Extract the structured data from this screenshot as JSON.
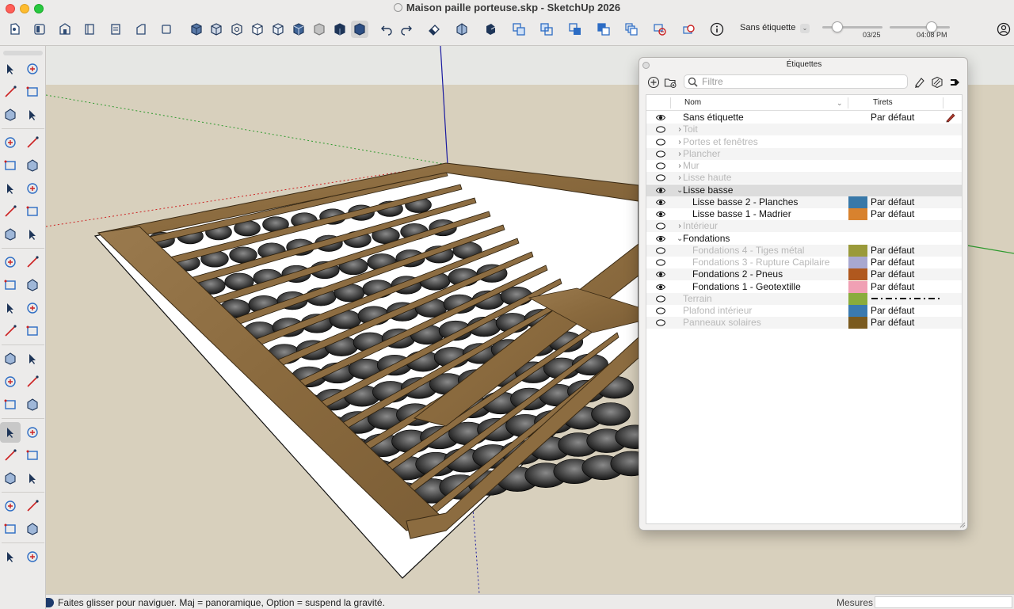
{
  "window": {
    "title": "Maison paille porteuse.skp - SketchUp 2026"
  },
  "toolbar": {
    "tag_select": "Sans étiquette",
    "date_slider_value": "03/25",
    "time_slider_value": "04:08 PM"
  },
  "status_bar": {
    "hint": "Faites glisser pour naviguer. Maj = panoramique, Option =  suspend la gravité.",
    "measurements_label": "Mesures",
    "measurements_value": ""
  },
  "tags_panel": {
    "title": "Étiquettes",
    "search_placeholder": "Filtre",
    "col_name": "Nom",
    "col_dashes": "Tirets",
    "rows": [
      {
        "name": "Sans étiquette",
        "visible": true,
        "level": 0,
        "disclosure": "",
        "color": "",
        "dashes": "Par défaut",
        "active": true
      },
      {
        "name": "Toit",
        "visible": false,
        "level": 0,
        "disclosure": "›",
        "color": "",
        "dashes": ""
      },
      {
        "name": "Portes et fenêtres",
        "visible": false,
        "level": 0,
        "disclosure": "›",
        "color": "",
        "dashes": ""
      },
      {
        "name": "Plancher",
        "visible": false,
        "level": 0,
        "disclosure": "›",
        "color": "",
        "dashes": ""
      },
      {
        "name": "Mur",
        "visible": false,
        "level": 0,
        "disclosure": "›",
        "color": "",
        "dashes": ""
      },
      {
        "name": "Lisse haute",
        "visible": false,
        "level": 0,
        "disclosure": "›",
        "color": "",
        "dashes": ""
      },
      {
        "name": "Lisse basse",
        "visible": true,
        "level": 0,
        "disclosure": "⌄",
        "color": "",
        "dashes": "",
        "selected": true
      },
      {
        "name": "Lisse basse 2 - Planches",
        "visible": true,
        "level": 1,
        "disclosure": "",
        "color": "#3878a8",
        "dashes": "Par défaut"
      },
      {
        "name": "Lisse basse 1 - Madrier",
        "visible": true,
        "level": 1,
        "disclosure": "",
        "color": "#d8822e",
        "dashes": "Par défaut"
      },
      {
        "name": "Intérieur",
        "visible": false,
        "level": 0,
        "disclosure": "›",
        "color": "",
        "dashes": ""
      },
      {
        "name": "Fondations",
        "visible": true,
        "level": 0,
        "disclosure": "⌄",
        "color": "",
        "dashes": ""
      },
      {
        "name": "Fondations 4 - Tiges métal",
        "visible": false,
        "level": 1,
        "disclosure": "",
        "color": "#9a9a3a",
        "dashes": "Par défaut"
      },
      {
        "name": "Fondations 3 - Rupture Capilaire",
        "visible": false,
        "level": 1,
        "disclosure": "",
        "color": "#a8a8d0",
        "dashes": "Par défaut"
      },
      {
        "name": "Fondations 2 - Pneus",
        "visible": true,
        "level": 1,
        "disclosure": "",
        "color": "#b0581e",
        "dashes": "Par défaut"
      },
      {
        "name": "Fondations 1 - Geotextille",
        "visible": true,
        "level": 1,
        "disclosure": "",
        "color": "#f0a0b4",
        "dashes": "Par défaut"
      },
      {
        "name": "Terrain",
        "visible": false,
        "level": 0,
        "disclosure": "",
        "color": "#8aac3c",
        "dashes": "",
        "dash_pattern": true
      },
      {
        "name": "Plafond intérieur",
        "visible": false,
        "level": 0,
        "disclosure": "",
        "color": "#3a7ab0",
        "dashes": "Par défaut"
      },
      {
        "name": "Panneaux solaires",
        "visible": false,
        "level": 0,
        "disclosure": "",
        "color": "#7a5a1e",
        "dashes": "Par défaut"
      }
    ]
  }
}
